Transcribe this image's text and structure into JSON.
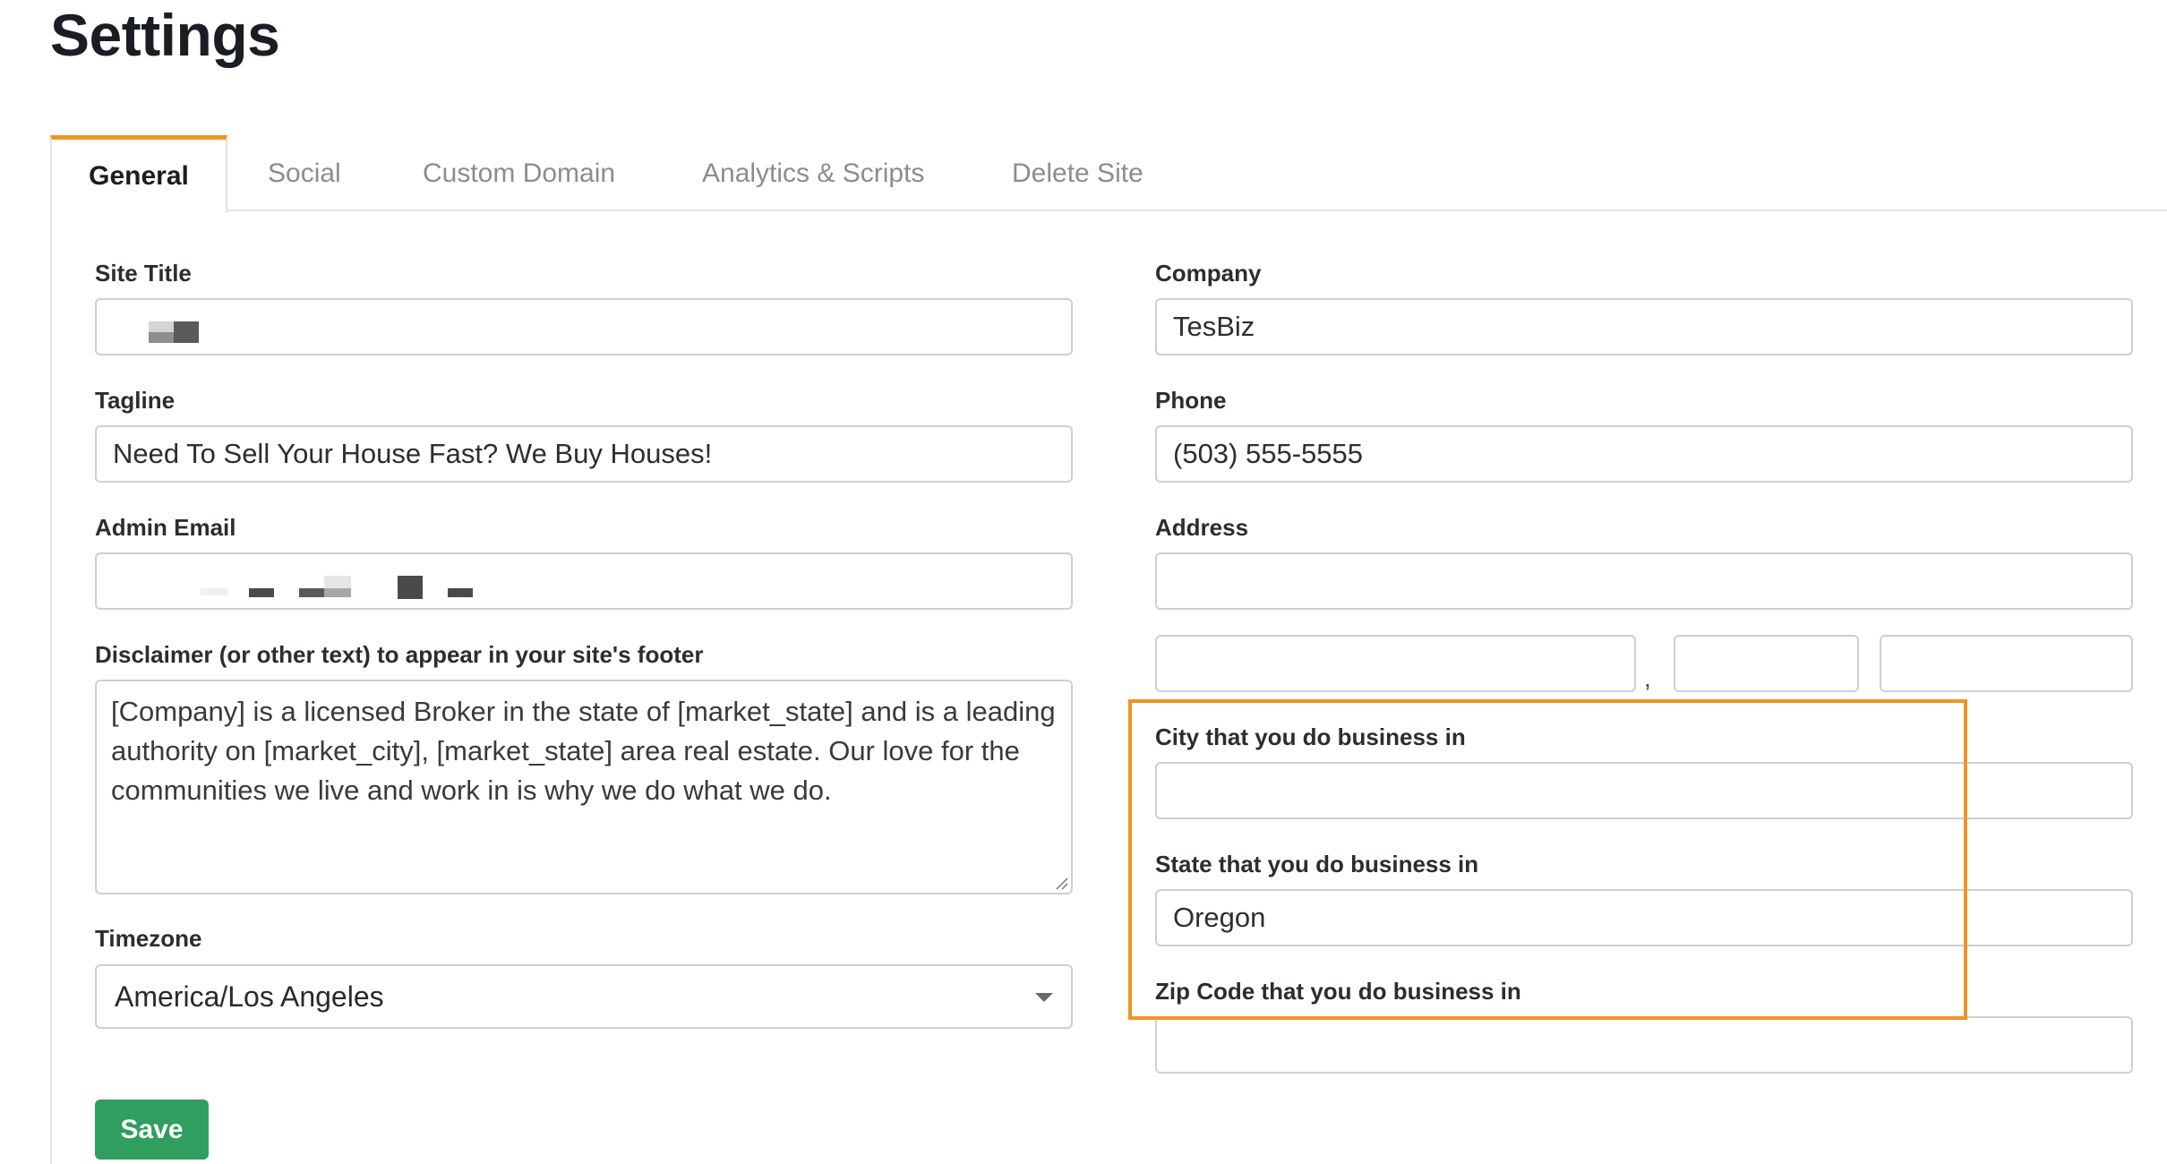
{
  "page": {
    "title": "Settings"
  },
  "tabs": [
    {
      "label": "General",
      "active": true
    },
    {
      "label": "Social",
      "active": false
    },
    {
      "label": "Custom Domain",
      "active": false
    },
    {
      "label": "Analytics & Scripts",
      "active": false
    },
    {
      "label": "Delete Site",
      "active": false
    }
  ],
  "left": {
    "site_title": {
      "label": "Site Title",
      "value": ""
    },
    "tagline": {
      "label": "Tagline",
      "value": "Need To Sell Your House Fast? We Buy Houses!"
    },
    "admin_email": {
      "label": "Admin Email",
      "value": ""
    },
    "disclaimer": {
      "label": "Disclaimer (or other text) to appear in your site's footer",
      "value": "[Company] is a licensed Broker in the state of [market_state] and is a leading authority on [market_city], [market_state] area real estate. Our love for the communities we live and work in is why we do what we do."
    },
    "timezone": {
      "label": "Timezone",
      "value": "America/Los Angeles"
    }
  },
  "right": {
    "company": {
      "label": "Company",
      "value": "TesBiz"
    },
    "phone": {
      "label": "Phone",
      "value": "(503) 555-5555"
    },
    "address": {
      "label": "Address",
      "value": ""
    },
    "address_separator": ",",
    "city_business": {
      "label": "City that you do business in",
      "value": ""
    },
    "state_business": {
      "label": "State that you do business in",
      "value": "Oregon"
    },
    "zip_business": {
      "label": "Zip Code that you do business in",
      "value": ""
    }
  },
  "actions": {
    "save_label": "Save"
  },
  "colors": {
    "accent_orange": "#f39325",
    "save_green": "#2f9e5f",
    "border_gray": "#cfcfcf",
    "tab_inactive": "#8c8c8c"
  }
}
